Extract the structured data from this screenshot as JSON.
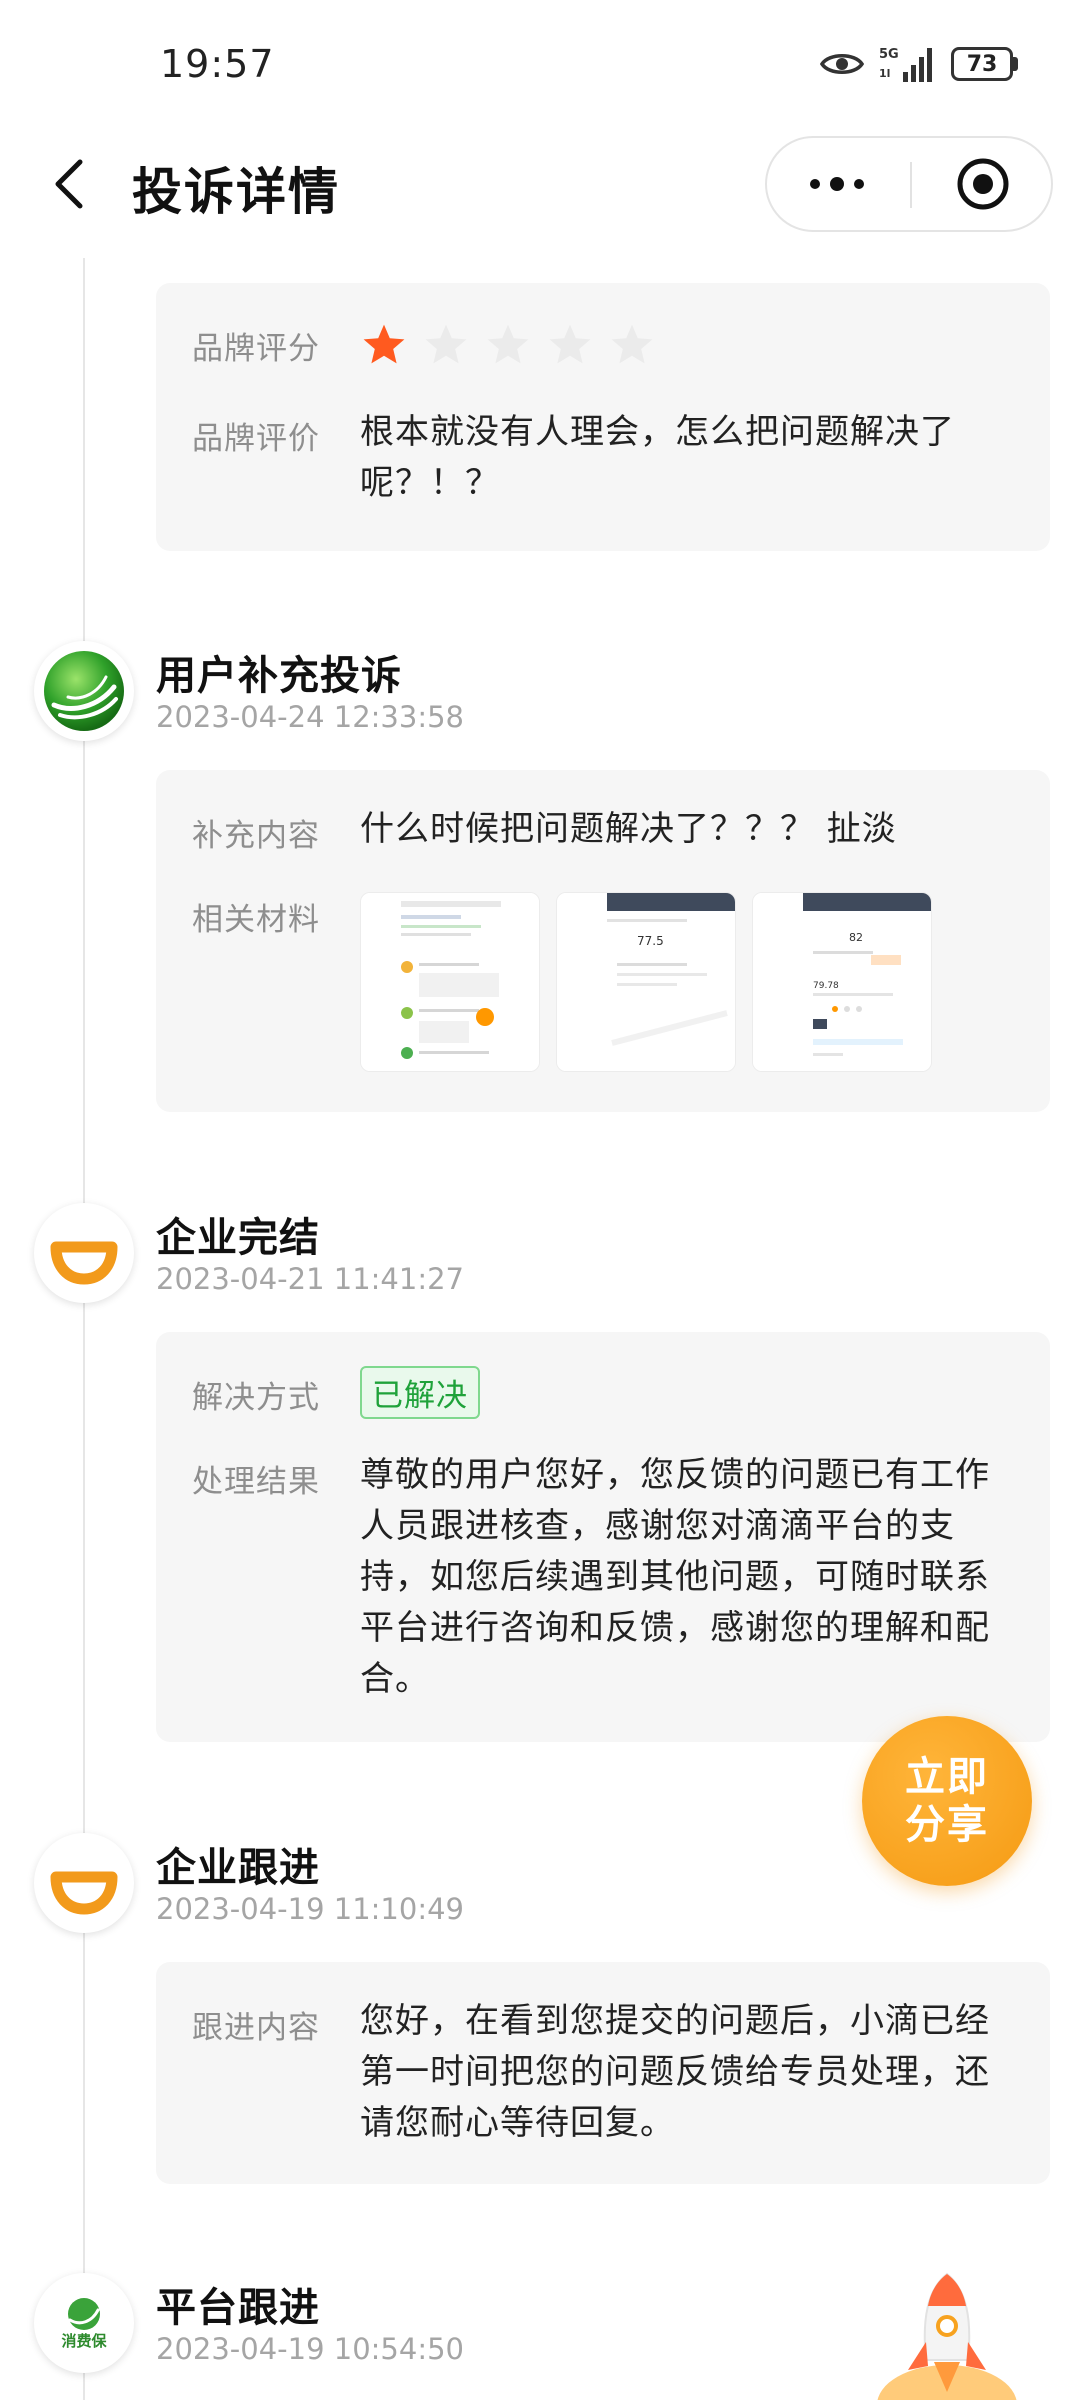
{
  "status_bar": {
    "time": "19:57",
    "network": "5G",
    "battery": "73"
  },
  "nav": {
    "title": "投诉详情"
  },
  "top_card": {
    "rating_label": "品牌评分",
    "rating_value": 1,
    "rating_max": 5,
    "review_label": "品牌评价",
    "review_text": "根本就没有人理会，怎么把问题解决了呢？！？"
  },
  "entries": [
    {
      "title": "用户补充投诉",
      "time": "2023-04-24 12:33:58",
      "content_label": "补充内容",
      "content": "什么时候把问题解决了？？？ 扯淡",
      "materials_label": "相关材料",
      "thumbnails": [
        {
          "value": "",
          "caption": ""
        },
        {
          "value": "77.5",
          "caption": ""
        },
        {
          "value": "82",
          "caption": "79.78"
        }
      ]
    },
    {
      "title": "企业完结",
      "time": "2023-04-21 11:41:27",
      "method_label": "解决方式",
      "method_value": "已解决",
      "result_label": "处理结果",
      "result_text": "尊敬的用户您好，您反馈的问题已有工作人员跟进核查，感谢您对滴滴平台的支持，如您后续遇到其他问题，可随时联系平台进行咨询和反馈，感谢您的理解和配合。"
    },
    {
      "title": "企业跟进",
      "time": "2023-04-19 11:10:49",
      "content_label": "跟进内容",
      "content": "您好，在看到您提交的问题后，小滴已经第一时间把您的问题反馈给专员处理，还请您耐心等待回复。"
    },
    {
      "title": "平台跟进",
      "time": "2023-04-19 10:54:50",
      "logo_text": "消费保"
    }
  ],
  "share_button": {
    "line1": "立即",
    "line2": "分享"
  },
  "colors": {
    "star_active": "#ff5a1f",
    "star_inactive": "#eeeeee",
    "didi_orange": "#f29a1b",
    "share_orange": "#f7a21f",
    "resolved_green": "#1fa23a"
  }
}
